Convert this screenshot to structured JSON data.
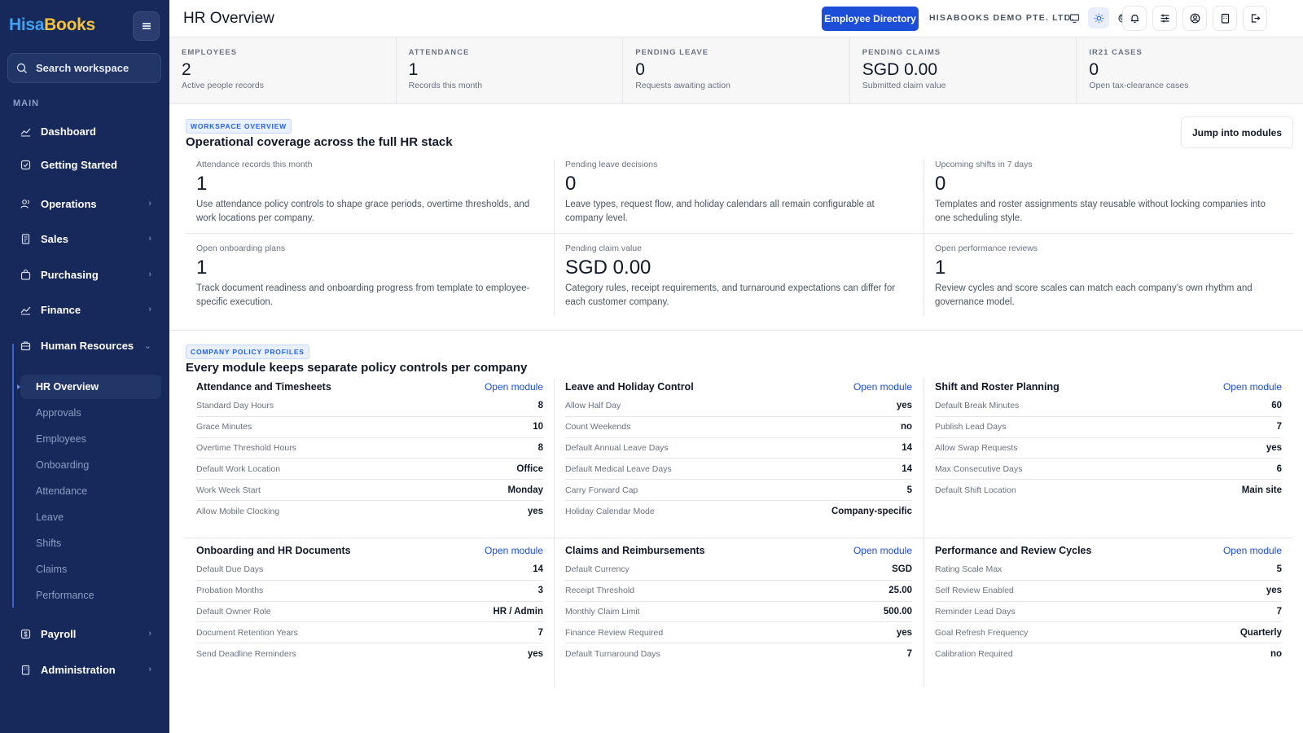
{
  "sidebar": {
    "logo_part1": "Hisa",
    "logo_part2": "Books",
    "search_placeholder": "Search workspace",
    "section_label": "MAIN",
    "items": [
      {
        "label": "Dashboard",
        "icon": "chart-icon"
      },
      {
        "label": "Getting Started",
        "icon": "checklist-icon"
      },
      {
        "label": "Operations",
        "icon": "users-icon"
      },
      {
        "label": "Sales",
        "icon": "receipt-icon"
      },
      {
        "label": "Purchasing",
        "icon": "bag-icon"
      },
      {
        "label": "Finance",
        "icon": "chart-icon"
      },
      {
        "label": "Human Resources",
        "icon": "briefcase-icon"
      },
      {
        "label": "Payroll",
        "icon": "dollar-icon"
      },
      {
        "label": "Administration",
        "icon": "building-icon"
      }
    ],
    "hr_sub": [
      "HR Overview",
      "Approvals",
      "Employees",
      "Onboarding",
      "Attendance",
      "Leave",
      "Shifts",
      "Claims",
      "Performance"
    ]
  },
  "header": {
    "title": "HR Overview",
    "directory_button": "Employee Directory",
    "company": "HISABOOKS DEMO PTE. LTD."
  },
  "stats": [
    {
      "label": "EMPLOYEES",
      "value": "2",
      "sub": "Active people records"
    },
    {
      "label": "ATTENDANCE",
      "value": "1",
      "sub": "Records this month"
    },
    {
      "label": "PENDING LEAVE",
      "value": "0",
      "sub": "Requests awaiting action"
    },
    {
      "label": "PENDING CLAIMS",
      "value": "SGD 0.00",
      "sub": "Submitted claim value"
    },
    {
      "label": "IR21 CASES",
      "value": "0",
      "sub": "Open tax-clearance cases"
    }
  ],
  "workspace": {
    "tag": "WORKSPACE OVERVIEW",
    "heading": "Operational coverage across the full HR stack",
    "jump_button": "Jump into modules",
    "metrics": [
      {
        "label": "Attendance records this month",
        "value": "1",
        "desc": "Use attendance policy controls to shape grace periods, overtime thresholds, and work locations per company."
      },
      {
        "label": "Pending leave decisions",
        "value": "0",
        "desc": "Leave types, request flow, and holiday calendars all remain configurable at company level."
      },
      {
        "label": "Upcoming shifts in 7 days",
        "value": "0",
        "desc": "Templates and roster assignments stay reusable without locking companies into one scheduling style."
      },
      {
        "label": "Open onboarding plans",
        "value": "1",
        "desc": "Track document readiness and onboarding progress from template to employee-specific execution."
      },
      {
        "label": "Pending claim value",
        "value": "SGD 0.00",
        "desc": "Category rules, receipt requirements, and turnaround expectations can differ for each customer company."
      },
      {
        "label": "Open performance reviews",
        "value": "1",
        "desc": "Review cycles and score scales can match each company’s own rhythm and governance model."
      }
    ]
  },
  "policies": {
    "tag": "COMPANY POLICY PROFILES",
    "heading": "Every module keeps separate policy controls per company",
    "link_label": "Open module",
    "cards": [
      {
        "title": "Attendance and Timesheets",
        "rows": [
          [
            "Standard Day Hours",
            "8"
          ],
          [
            "Grace Minutes",
            "10"
          ],
          [
            "Overtime Threshold Hours",
            "8"
          ],
          [
            "Default Work Location",
            "Office"
          ],
          [
            "Work Week Start",
            "Monday"
          ],
          [
            "Allow Mobile Clocking",
            "yes"
          ]
        ]
      },
      {
        "title": "Leave and Holiday Control",
        "rows": [
          [
            "Allow Half Day",
            "yes"
          ],
          [
            "Count Weekends",
            "no"
          ],
          [
            "Default Annual Leave Days",
            "14"
          ],
          [
            "Default Medical Leave Days",
            "14"
          ],
          [
            "Carry Forward Cap",
            "5"
          ],
          [
            "Holiday Calendar Mode",
            "Company-specific"
          ]
        ]
      },
      {
        "title": "Shift and Roster Planning",
        "rows": [
          [
            "Default Break Minutes",
            "60"
          ],
          [
            "Publish Lead Days",
            "7"
          ],
          [
            "Allow Swap Requests",
            "yes"
          ],
          [
            "Max Consecutive Days",
            "6"
          ],
          [
            "Default Shift Location",
            "Main site"
          ]
        ]
      },
      {
        "title": "Onboarding and HR Documents",
        "rows": [
          [
            "Default Due Days",
            "14"
          ],
          [
            "Probation Months",
            "3"
          ],
          [
            "Default Owner Role",
            "HR / Admin"
          ],
          [
            "Document Retention Years",
            "7"
          ],
          [
            "Send Deadline Reminders",
            "yes"
          ]
        ]
      },
      {
        "title": "Claims and Reimbursements",
        "rows": [
          [
            "Default Currency",
            "SGD"
          ],
          [
            "Receipt Threshold",
            "25.00"
          ],
          [
            "Monthly Claim Limit",
            "500.00"
          ],
          [
            "Finance Review Required",
            "yes"
          ],
          [
            "Default Turnaround Days",
            "7"
          ]
        ]
      },
      {
        "title": "Performance and Review Cycles",
        "rows": [
          [
            "Rating Scale Max",
            "5"
          ],
          [
            "Self Review Enabled",
            "yes"
          ],
          [
            "Reminder Lead Days",
            "7"
          ],
          [
            "Goal Refresh Frequency",
            "Quarterly"
          ],
          [
            "Calibration Required",
            "no"
          ]
        ]
      }
    ]
  }
}
